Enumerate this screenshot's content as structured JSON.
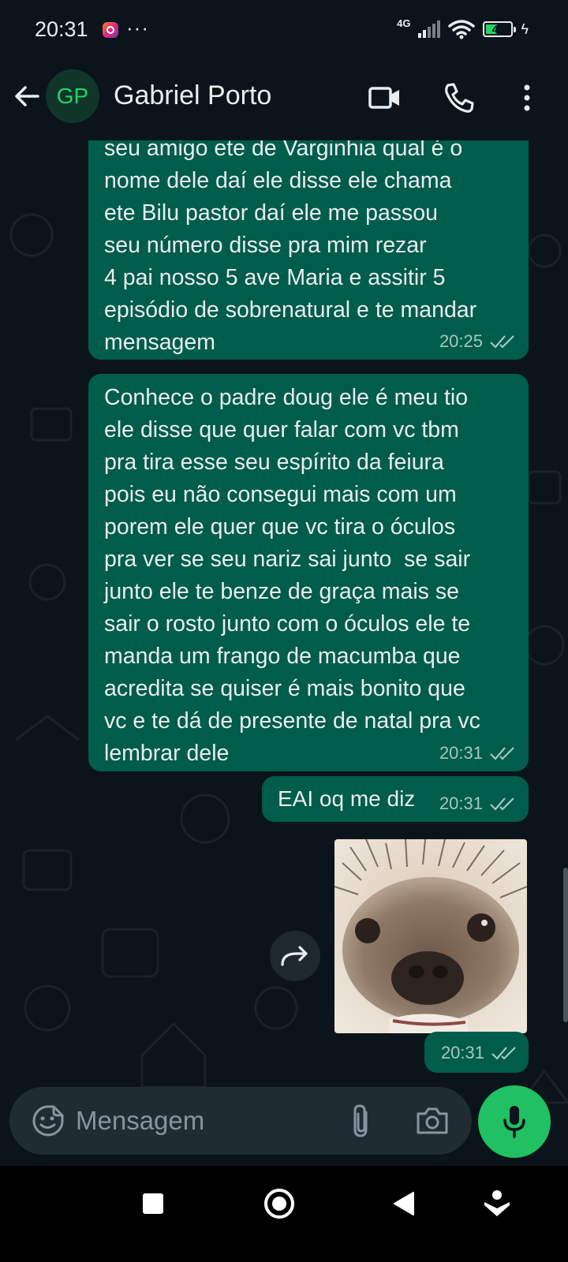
{
  "status_bar": {
    "time": "20:31",
    "dots": "···",
    "network": "4G",
    "battery": "41",
    "icons": [
      "instagram-icon",
      "signal-icon",
      "wifi-icon",
      "battery-icon",
      "charging-icon"
    ]
  },
  "header": {
    "avatar_initials": "GP",
    "contact_name": "Gabriel Porto",
    "icons": [
      "back-arrow-icon",
      "video-call-icon",
      "phone-icon",
      "more-vert-icon"
    ]
  },
  "messages": [
    {
      "type": "text",
      "outgoing": true,
      "text": "seu amigo ete de Varginhia qual é o\nnome dele daí ele disse ele chama\nete Bilu pastor daí ele me passou\nseu número disse pra mim rezar\n4 pai nosso 5 ave Maria e assitir 5\nepisódio de sobrenatural e te mandar\nmensagem",
      "time": "20:25",
      "status": "read"
    },
    {
      "type": "text",
      "outgoing": true,
      "text": "Conhece o padre doug ele é meu tio\nele disse que quer falar com vc tbm\npra tira esse seu espírito da feiura\npois eu não consegui mais com um\nporem ele quer que vc tira o óculos\npra ver se seu nariz sai junto  se sair\njunto ele te benze de graça mais se\nsair o rosto junto com o óculos ele te\nmanda um frango de macumba que\nacredita se quiser é mais bonito que\nvc e te dá de presente de natal pra vc\nlembrar dele",
      "time": "20:31",
      "status": "read"
    },
    {
      "type": "text",
      "outgoing": true,
      "text": "EAI oq me diz",
      "time": "20:31",
      "status": "read"
    },
    {
      "type": "sticker",
      "outgoing": true,
      "description_icon": "hedgehog-sticker",
      "time": "20:31",
      "status": "read"
    }
  ],
  "input": {
    "placeholder": "Mensagem",
    "icons": [
      "emoji-sticker-icon",
      "attach-icon",
      "camera-icon",
      "mic-icon"
    ]
  },
  "nav_bar": {
    "icons": [
      "recents-square-icon",
      "home-circle-icon",
      "back-triangle-icon",
      "assistant-icon"
    ]
  },
  "colors": {
    "background": "#0b141a",
    "outgoing_bubble": "#005c4b",
    "accent_green": "#21c063",
    "input_bg": "#1f2c34",
    "secondary_text": "#8696a0"
  }
}
